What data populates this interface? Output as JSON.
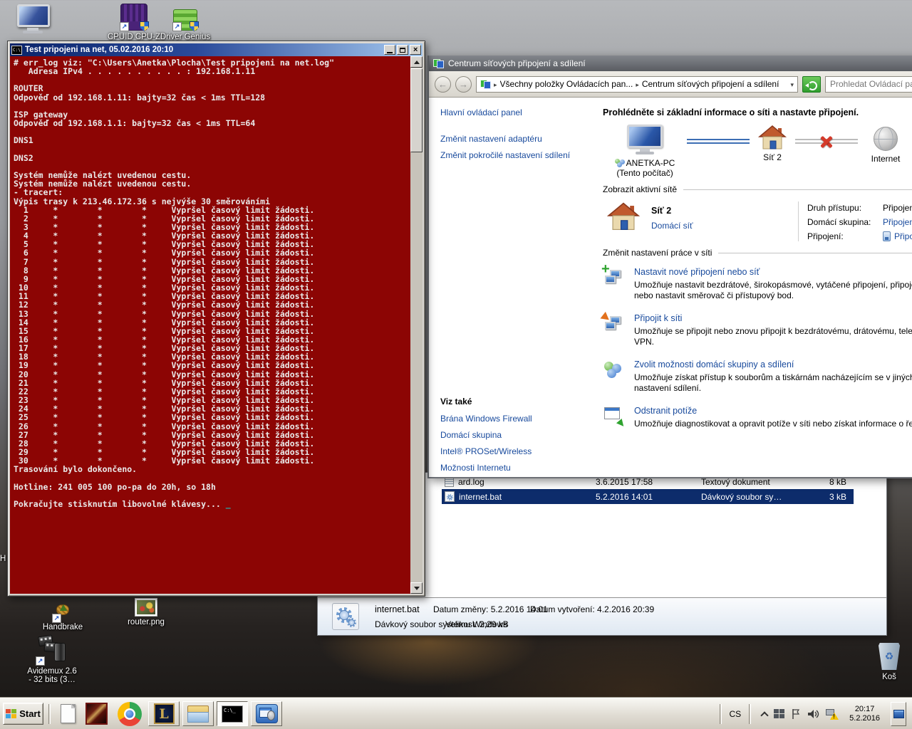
{
  "desktop": {
    "icons": {
      "computer": {
        "label": ""
      },
      "cpuz": {
        "label": "CPUID CPU-Z"
      },
      "driver_genius": {
        "label": "Driver Genius"
      },
      "handbrake": {
        "label": "Handbrake"
      },
      "router_png": {
        "label": "router.png"
      },
      "avidemux": {
        "label_line1": "Avidemux 2.6",
        "label_line2": "- 32 bits (3…"
      },
      "recycle_bin": {
        "label": "Koš"
      }
    },
    "covered_icon_fragment": "H"
  },
  "terminal": {
    "title": "Test pripojeni na net, 05.02.2016 20:10",
    "colors": {
      "background": "#8c0504",
      "text": "#eaeaea",
      "cursor": "#17c2c2",
      "titlebar": "#0a246a"
    },
    "lines_before": [
      "# err_log viz: \"C:\\Users\\Anetka\\Plocha\\Test pripojeni na net.log\"",
      "   Adresa IPv4 . . . . . . . . . . : 192.168.1.11",
      "",
      "ROUTER",
      "Odpověď od 192.168.1.11: bajty=32 čas < 1ms TTL=128",
      "",
      "ISP gateway",
      "Odpověď od 192.168.1.1: bajty=32 čas < 1ms TTL=64",
      "",
      "DNS1",
      "",
      "DNS2",
      "",
      "Systém nemůže nalézt uvedenou cestu.",
      "Systém nemůže nalézt uvedenou cestu.",
      "- tracert:",
      "Výpis trasy k 213.46.172.36 s nejvýše 30 směrováními"
    ],
    "trace": {
      "start": 1,
      "end": 30,
      "columns": "     *        *        *     ",
      "message": "Vypršel časový limit žádosti."
    },
    "lines_after": [
      "Trasování bylo dokončeno.",
      "",
      "Hotline: 241 005 100 po-pa do 20h, so 18h",
      "",
      "Pokračujte stisknutím libovolné klávesy... "
    ],
    "cursor": "_"
  },
  "network_center": {
    "title": "Centrum síťových připojení a sdílení",
    "address": {
      "breadcrumb_root": "Všechny položky Ovládacích pan...",
      "breadcrumb_current": "Centrum síťových připojení a sdílení",
      "search_placeholder": "Prohledat Ovládací panel"
    },
    "sidebar": {
      "home": "Hlavní ovládací panel",
      "links": [
        "Změnit nastavení adaptéru",
        "Změnit pokročilé nastavení sdílení"
      ],
      "see_also_title": "Viz také",
      "see_also_links": [
        "Brána Windows Firewall",
        "Domácí skupina",
        "Intel® PROSet/Wireless",
        "Možnosti Internetu"
      ]
    },
    "heading": "Prohlédněte si základní informace o síti a nastavte připojení.",
    "map": {
      "computer_name": "ANETKA-PC",
      "computer_sub": "(Tento počítač)",
      "network_name": "Síť 2",
      "internet_label": "Internet"
    },
    "active_networks": {
      "section_title": "Zobrazit aktivní sítě",
      "network_name": "Síť 2",
      "network_type": "Domácí síť",
      "access_label": "Druh přístupu:",
      "access_value": "Připojení k dispozici",
      "homegroup_label": "Domácí skupina:",
      "homegroup_value": "Připojeno",
      "connection_label": "Připojení:",
      "connection_value": "Připojení k"
    },
    "tasks_section_title": "Změnit nastavení práce v síti",
    "tasks": [
      {
        "title": "Nastavit nové připojení nebo síť",
        "lines": [
          "Umožňuje nastavit bezdrátové, širokopásmové, vytáčené připojení, připojení adhoc",
          "nebo nastavit směrovač či přístupový bod."
        ]
      },
      {
        "title": "Připojit k síti",
        "lines": [
          "Umožňuje se připojit nebo znovu připojit k bezdrátovému, drátovému, telefonickému",
          "VPN."
        ]
      },
      {
        "title": "Zvolit možnosti domácí skupiny a sdílení",
        "lines": [
          "Umožňuje získat přístup k souborům a tiskárnám nacházejícím se v jiných síťových p",
          "nastavení sdílení."
        ]
      },
      {
        "title": "Odstranit potíže",
        "lines": [
          "Umožňuje diagnostikovat a opravit potíže v síti nebo získat informace o řešení potíží"
        ]
      }
    ]
  },
  "explorer": {
    "rows": [
      {
        "name": "ard.log",
        "modified": "3.6.2015 17:58",
        "type": "Textový dokument",
        "size": "8 kB"
      },
      {
        "name": "internet.bat",
        "modified": "5.2.2016 14:01",
        "type": "Dávkový soubor sy…",
        "size": "3 kB"
      }
    ],
    "details": {
      "name": "internet.bat",
      "type": "Dávkový soubor systému Windows",
      "modified_label": "Datum změny:",
      "modified_value": "5.2.2016 14:01",
      "size_label": "Velikost:",
      "size_value": "2,29 kB",
      "created_label": "Datum vytvoření:",
      "created_value": "4.2.2016 20:39"
    }
  },
  "taskbar": {
    "start_label": "Start",
    "language": "CS",
    "clock_time": "20:17",
    "clock_date": "5.2.2016"
  }
}
